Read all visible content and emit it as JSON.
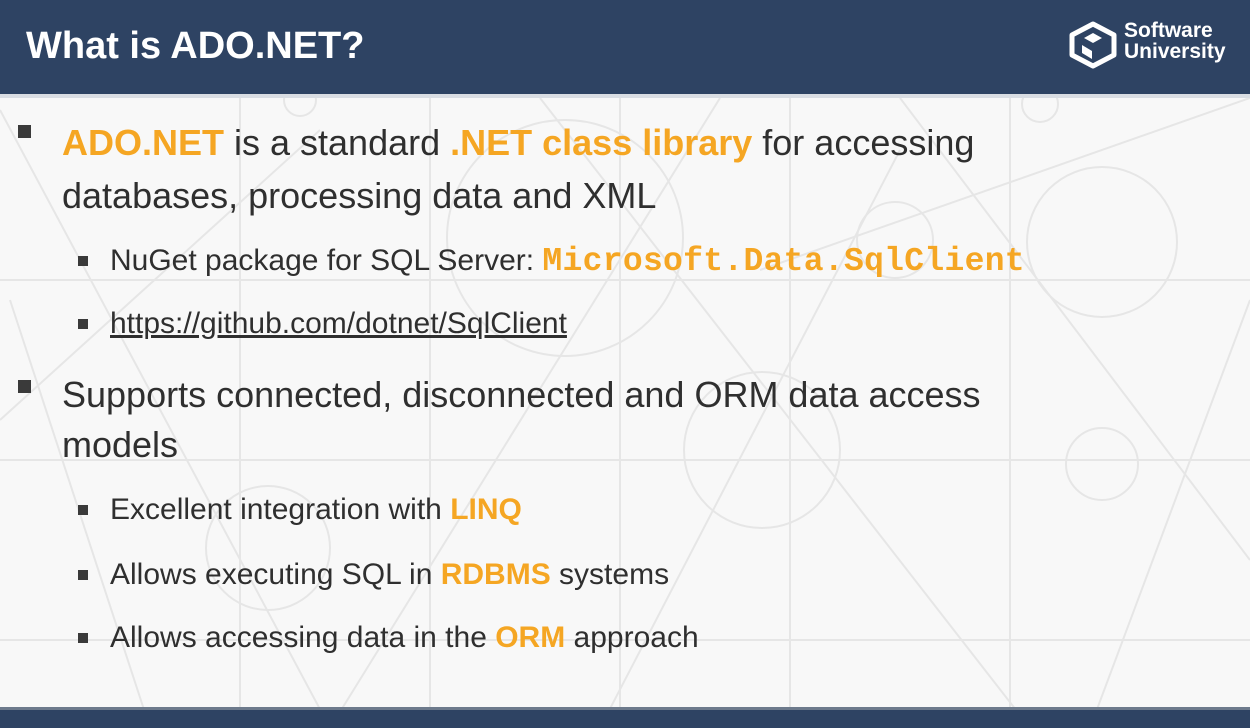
{
  "slide": {
    "title": "What is ADO.NET?",
    "logo": {
      "line1": "Software",
      "line2": "University",
      "icon": "softuni-logo-icon"
    },
    "bullets": [
      {
        "parts": [
          "ADO.NET",
          " is a standard ",
          ".NET class library",
          " for accessing"
        ],
        "continuation": "databases, processing data and XML",
        "sub": [
          {
            "prefix": "NuGet package for SQL Server: ",
            "code": "Microsoft.Data.SqlClient"
          },
          {
            "link": "https://github.com/dotnet/SqlClient"
          }
        ]
      },
      {
        "text": "Supports connected, disconnected and ORM data access",
        "continuation": "models",
        "sub": [
          {
            "prefix": "Excellent integration with ",
            "highlight": "LINQ",
            "suffix": ""
          },
          {
            "prefix": "Allows executing SQL in ",
            "highlight": "RDBMS",
            "suffix": " systems"
          },
          {
            "prefix": "Allows accessing data in the ",
            "highlight": "ORM",
            "suffix": " approach"
          }
        ]
      }
    ]
  },
  "colors": {
    "header": "#2e4363",
    "accent": "#f5a623",
    "text": "#2f2f2f",
    "background": "#f8f8f8"
  }
}
